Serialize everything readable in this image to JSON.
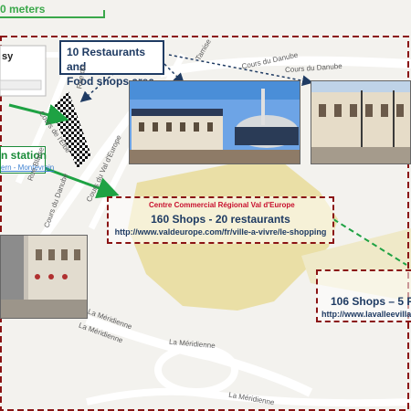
{
  "scale": {
    "label": "0 meters"
  },
  "header_fragment": "sy",
  "callout_food": {
    "line1": "10 Restaurants and",
    "line2": "Food shops area"
  },
  "station": {
    "title": "n station",
    "links": "ern - Montevrain"
  },
  "mall": {
    "brand": "Centre Commercial Régional Val d'Europe",
    "headline": "160 Shops  - 20 restaurants",
    "url": "http://www.valdeurope.com/fr/ville-a-vivre/le-shopping"
  },
  "outlet": {
    "headline": "106 Shops – 5 Fo",
    "url": "http://www.lavalleevillag"
  },
  "streets": {
    "cours_du_danube_1": "Cours du Danube",
    "cours_du_danube_2": "Cours du Danube",
    "cours_du_danube_3": "Cours du Danube",
    "cours_de_l_elbe": "Cours de l'Elbe",
    "cours_du_danube_diag": "Cours du Danube",
    "rue_de_la_tamise": "Rue de la Tamise",
    "rue_blaise": "Rue Blaise",
    "la_meridienne_1": "La Méridienne",
    "la_meridienne_2": "La Méridienne",
    "la_meridienne_3": "La Méridienne",
    "la_meridienne_4": "La Méridienne",
    "rue_dn": "Rue du",
    "rue_ro": "Rue de l'",
    "tamise": "Tamise",
    "val_d_europe": "Cours du Val d'Europe"
  },
  "colors": {
    "route_green": "#1ea243",
    "dash_red": "#8a1414",
    "navy": "#1f3b63",
    "mall_area": "#eadfa6"
  }
}
